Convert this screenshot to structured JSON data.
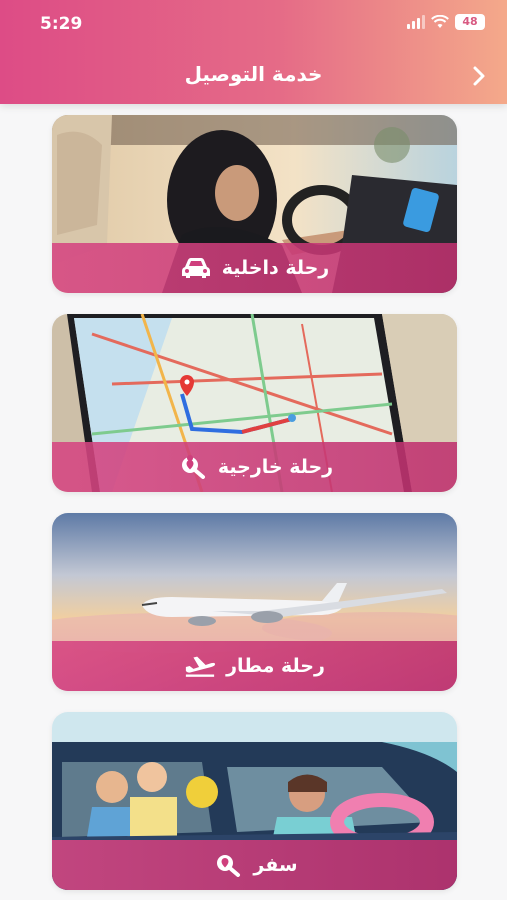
{
  "status_bar": {
    "time": "5:29",
    "battery": "48"
  },
  "header": {
    "title": "خدمة التوصيل",
    "back_icon": "chevron-right-icon"
  },
  "colors": {
    "accent": "#dd4c86",
    "accent_light": "#f4a98a",
    "band": "#d64682"
  },
  "cards": [
    {
      "label": "رحلة داخلية",
      "icon": "car-icon"
    },
    {
      "label": "رحلة خارجية",
      "icon": "location-search-icon"
    },
    {
      "label": "رحلة مطار",
      "icon": "airplane-takeoff-icon"
    },
    {
      "label": "سفر",
      "icon": "location-search-icon"
    }
  ]
}
